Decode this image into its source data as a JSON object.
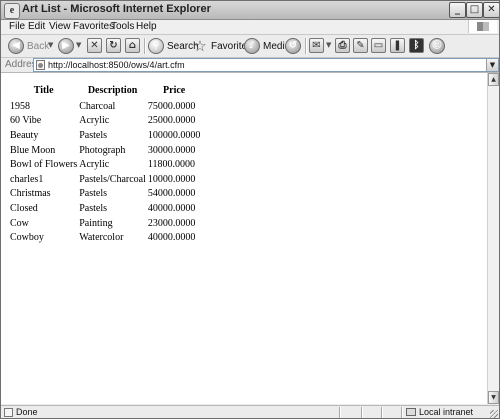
{
  "window": {
    "title": "Art List - Microsoft Internet Explorer",
    "minimize_glyph": "_",
    "maximize_glyph": "□",
    "close_glyph": "✕"
  },
  "menu": {
    "items": [
      "File",
      "Edit",
      "View",
      "Favorites",
      "Tools",
      "Help"
    ]
  },
  "toolbar": {
    "back_label": "Back",
    "search_label": "Search",
    "favorites_label": "Favorites",
    "media_label": "Media"
  },
  "address": {
    "label": "Address",
    "url": "http://localhost:8500/ows/4/art.cfm"
  },
  "table": {
    "headers": [
      "Title",
      "Description",
      "Price"
    ],
    "rows": [
      [
        "1958",
        "Charcoal",
        "75000.0000"
      ],
      [
        "60 Vibe",
        "Acrylic",
        "25000.0000"
      ],
      [
        "Beauty",
        "Pastels",
        "100000.0000"
      ],
      [
        "Blue Moon",
        "Photograph",
        "30000.0000"
      ],
      [
        "Bowl of Flowers",
        "Acrylic",
        "11800.0000"
      ],
      [
        "charles1",
        "Pastels/Charcoal",
        "10000.0000"
      ],
      [
        "Christmas",
        "Pastels",
        "54000.0000"
      ],
      [
        "Closed",
        "Pastels",
        "40000.0000"
      ],
      [
        "Cow",
        "Painting",
        "23000.0000"
      ],
      [
        "Cowboy",
        "Watercolor",
        "40000.0000"
      ]
    ]
  },
  "status": {
    "text": "Done",
    "zone": "Local intranet"
  }
}
